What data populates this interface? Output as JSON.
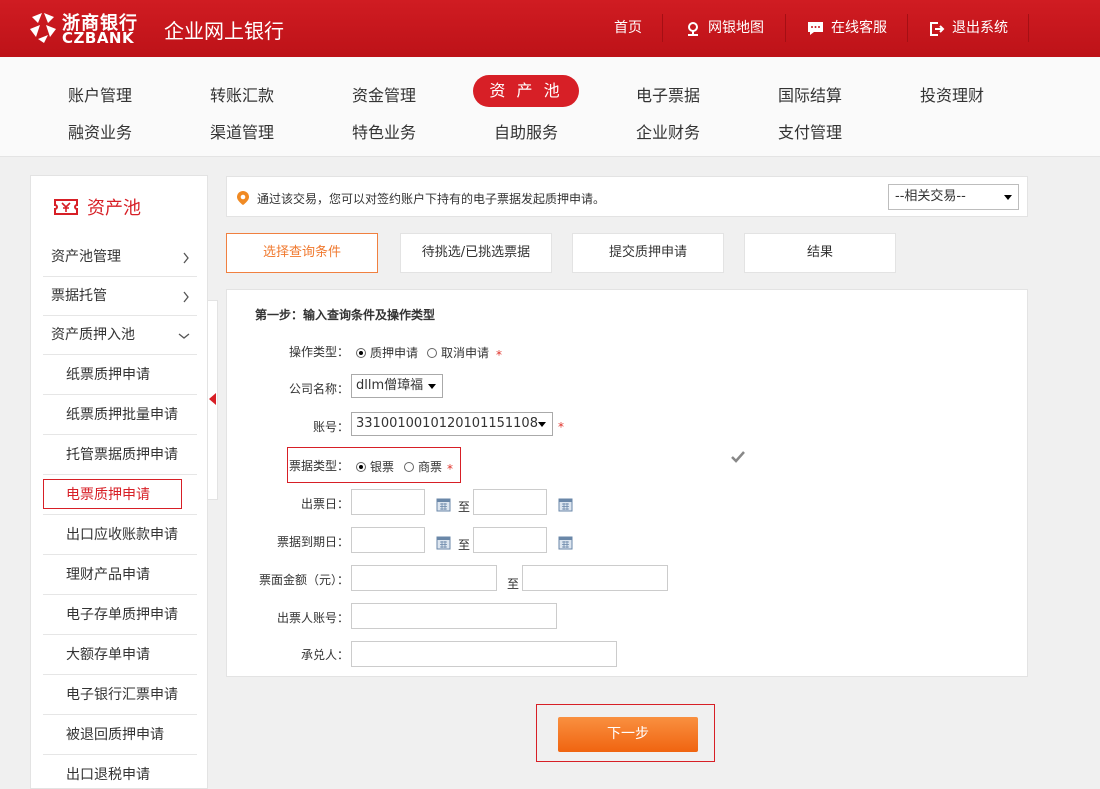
{
  "header": {
    "logo_cn": "浙商银行",
    "logo_en": "CZBANK",
    "title": "企业网上银行",
    "links": [
      {
        "label": "首页",
        "icon": "none"
      },
      {
        "label": "网银地图",
        "icon": "map-pin-icon"
      },
      {
        "label": "在线客服",
        "icon": "chat-icon"
      },
      {
        "label": "退出系统",
        "icon": "logout-icon"
      }
    ]
  },
  "nav": {
    "row1": [
      "账户管理",
      "转账汇款",
      "资金管理",
      "资 产 池",
      "电子票据",
      "国际结算",
      "投资理财"
    ],
    "row2": [
      "融资业务",
      "渠道管理",
      "特色业务",
      "自助服务",
      "企业财务",
      "支付管理"
    ],
    "active": "资 产 池"
  },
  "sidebar": {
    "title": "资产池",
    "items": [
      {
        "label": "资产池管理",
        "chevron": ">"
      },
      {
        "label": "票据托管",
        "chevron": ">"
      },
      {
        "label": "资产质押入池",
        "chevron": "v"
      },
      {
        "label": "纸票质押申请"
      },
      {
        "label": "纸票质押批量申请"
      },
      {
        "label": "托管票据质押申请"
      },
      {
        "label": "电票质押申请"
      },
      {
        "label": "出口应收账款申请"
      },
      {
        "label": "理财产品申请"
      },
      {
        "label": "电子存单质押申请"
      },
      {
        "label": "大额存单申请"
      },
      {
        "label": "电子银行汇票申请"
      },
      {
        "label": "被退回质押申请"
      },
      {
        "label": "出口退税申请"
      }
    ]
  },
  "info": {
    "text": "通过该交易，您可以对签约账户下持有的电子票据发起质押申请。",
    "related_select": "--相关交易--"
  },
  "steps": [
    "选择查询条件",
    "待挑选/已挑选票据",
    "提交质押申请",
    "结果"
  ],
  "form": {
    "step_title": "第一步：输入查询条件及操作类型",
    "op_type_label": "操作类型：",
    "op_options": [
      "质押申请",
      "取消申请"
    ],
    "company_label": "公司名称：",
    "company_value": "dllm僧璋福",
    "account_label": "账号：",
    "account_value": "3310010010120101151108",
    "bill_type_label": "票据类型：",
    "bill_options": [
      "银票",
      "商票"
    ],
    "issue_date_label": "出票日：",
    "due_date_label": "票据到期日：",
    "amount_label": "票面金额（元）：",
    "drawer_account_label": "出票人账号：",
    "acceptor_label": "承兑人：",
    "to": "至",
    "required": "*"
  },
  "next_button": "下一步",
  "colors": {
    "brand_red": "#d71f26",
    "accent_orange": "#f07a30"
  }
}
